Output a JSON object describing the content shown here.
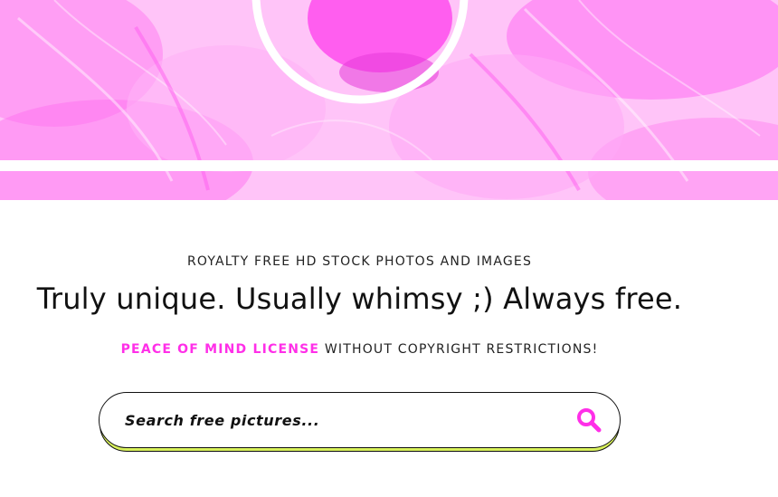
{
  "hero": {
    "image": "pink-tinted-fluffy-dog-photo"
  },
  "intro": {
    "tagline": "ROYALTY FREE HD STOCK PHOTOS AND IMAGES",
    "headline": "Truly unique. Usually whimsy ;) Always free.",
    "license_link": "PEACE OF MIND LICENSE",
    "license_rest": " WITHOUT COPYRIGHT RESTRICTIONS!"
  },
  "search": {
    "placeholder": "Search free pictures...",
    "value": "",
    "button_icon": "magnifier-icon"
  },
  "colors": {
    "accent": "#ff2fe8",
    "hero_tint": "#ff5cf0",
    "search_shadow": "#d9f25c"
  }
}
